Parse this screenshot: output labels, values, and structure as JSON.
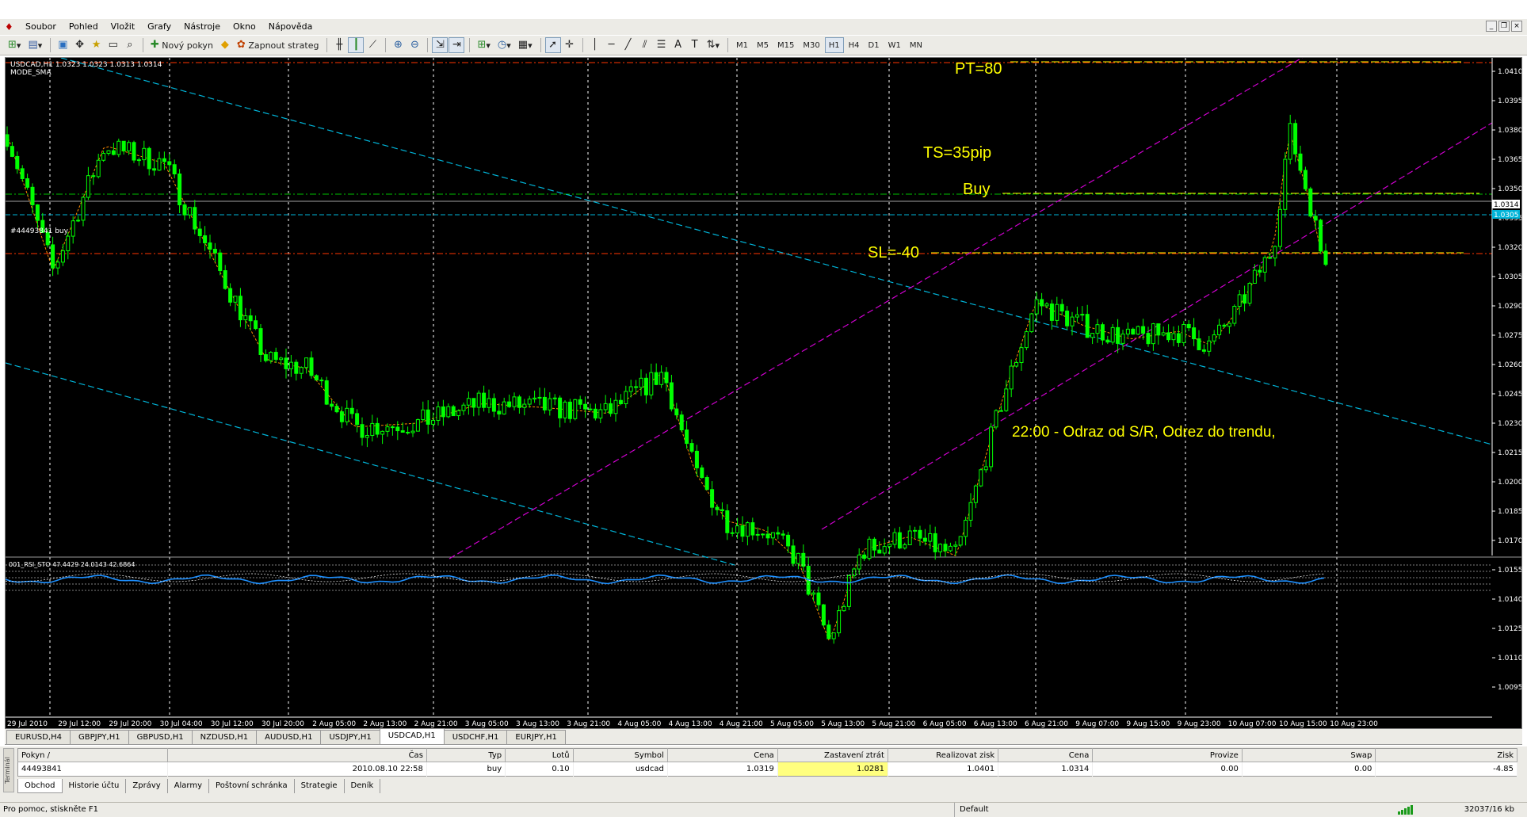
{
  "menu": [
    "Soubor",
    "Pohled",
    "Vložit",
    "Grafy",
    "Nástroje",
    "Okno",
    "Nápověda"
  ],
  "toolbar": {
    "new_order": "Nový pokyn",
    "expert": "Zapnout strateg",
    "timeframes": [
      "M1",
      "M5",
      "M15",
      "M30",
      "H1",
      "H4",
      "D1",
      "W1",
      "MN"
    ],
    "active_timeframe": "H1"
  },
  "chart": {
    "header_line1": "USDCAD,H1  1.0323 1.0323 1.0313 1.0314",
    "header_line2": "MODE_SMA",
    "order_label": "#44493841 buy",
    "price_ticks": [
      "1.0410",
      "1.0395",
      "1.0380",
      "1.0365",
      "1.0350",
      "1.0335",
      "1.0320",
      "1.0305",
      "1.0290",
      "1.0275",
      "1.0260",
      "1.0245",
      "1.0230",
      "1.0215",
      "1.0200",
      "1.0185",
      "1.0170",
      "1.0155",
      "1.0140",
      "1.0125",
      "1.0110",
      "1.0095"
    ],
    "current_price": "1.0314",
    "stop_price": "1.0305",
    "time_ticks": [
      "29 Jul 2010",
      "29 Jul 12:00",
      "29 Jul 20:00",
      "30 Jul 04:00",
      "30 Jul 12:00",
      "30 Jul 20:00",
      "2 Aug 05:00",
      "2 Aug 13:00",
      "2 Aug 21:00",
      "3 Aug 05:00",
      "3 Aug 13:00",
      "3 Aug 21:00",
      "4 Aug 05:00",
      "4 Aug 13:00",
      "4 Aug 21:00",
      "5 Aug 05:00",
      "5 Aug 13:00",
      "5 Aug 21:00",
      "6 Aug 05:00",
      "6 Aug 13:00",
      "6 Aug 21:00",
      "9 Aug 07:00",
      "9 Aug 15:00",
      "9 Aug 23:00",
      "10 Aug 07:00",
      "10 Aug 15:00",
      "10 Aug 23:00"
    ],
    "annotations": {
      "pt": "PT=80",
      "ts": "TS=35pip",
      "buy": "Buy",
      "sl": "SL=-40",
      "note": "22:00 - Odraz od S/R, Odrez do trendu,"
    },
    "indicator_label": "001_RSI_STO 47.4429 24.0143 42.6864",
    "colors": {
      "bull": "#00ff00",
      "annotation": "#ffff00",
      "channel": "#d000d0",
      "trendline": "#00b4d8",
      "sl_tp_line": "#ff3300",
      "buy_line": "#00c000",
      "ma": "#ff8c00"
    }
  },
  "symbol_tabs": [
    "EURUSD,H4",
    "GBPJPY,H1",
    "GBPUSD,H1",
    "NZDUSD,H1",
    "AUDUSD,H1",
    "USDJPY,H1",
    "USDCAD,H1",
    "USDCHF,H1",
    "EURJPY,H1"
  ],
  "active_symbol_tab": "USDCAD,H1",
  "terminal": {
    "side_label": "Terminál",
    "headers": [
      "Pokyn  /",
      "Čas",
      "Typ",
      "Lotů",
      "Symbol",
      "Cena",
      "Zastavení ztrát",
      "Realizovat zisk",
      "Cena",
      "Provize",
      "Swap",
      "Zisk"
    ],
    "row": [
      "44493841",
      "2010.08.10 22:58",
      "buy",
      "0.10",
      "usdcad",
      "1.0319",
      "1.0281",
      "1.0401",
      "1.0314",
      "0.00",
      "0.00",
      "-4.85"
    ],
    "tabs": [
      "Obchod",
      "Historie účtu",
      "Zprávy",
      "Alarmy",
      "Poštovní schránka",
      "Strategie",
      "Deník"
    ],
    "active_tab": "Obchod"
  },
  "status": {
    "help": "Pro pomoc, stiskněte F1",
    "profile": "Default",
    "traffic": "32037/16 kb"
  }
}
